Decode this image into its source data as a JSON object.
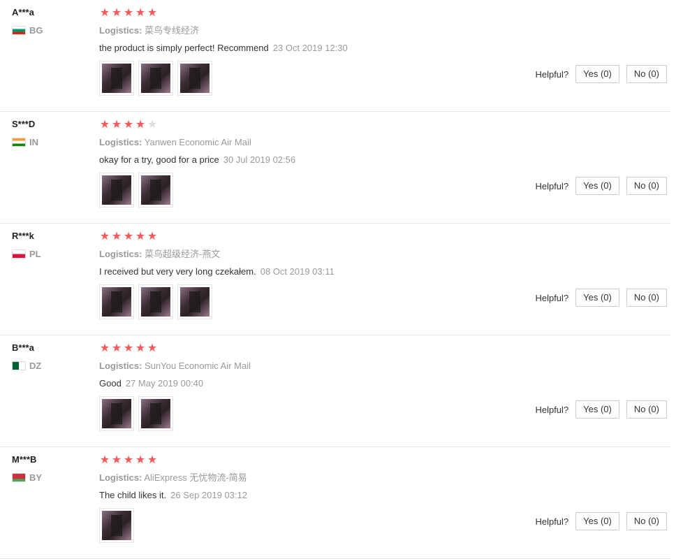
{
  "labels": {
    "logistics": "Logistics:",
    "helpful": "Helpful?"
  },
  "colors": {
    "star_on": "#f2595a",
    "star_off": "#dddddd"
  },
  "reviews": [
    {
      "user": "A***a",
      "country": "BG",
      "rating": 5,
      "logistics": "菜鸟专线经济",
      "text": "the product is simply perfect! Recommend",
      "date": "23 Oct 2019 12:30",
      "image_count": 3,
      "yes": "Yes (0)",
      "no": "No (0)"
    },
    {
      "user": "S***D",
      "country": "IN",
      "rating": 4,
      "logistics": "Yanwen Economic Air Mail",
      "text": "okay for a try, good for a price",
      "date": "30 Jul 2019 02:56",
      "image_count": 2,
      "yes": "Yes (0)",
      "no": "No (0)"
    },
    {
      "user": "R***k",
      "country": "PL",
      "rating": 5,
      "logistics": "菜鸟超级经济-燕文",
      "text": "I received but very very long czekałem.",
      "date": "08 Oct 2019 03:11",
      "image_count": 3,
      "yes": "Yes (0)",
      "no": "No (0)"
    },
    {
      "user": "B***a",
      "country": "DZ",
      "rating": 5,
      "logistics": "SunYou Economic Air Mail",
      "text": "Good",
      "date": "27 May 2019 00:40",
      "image_count": 2,
      "yes": "Yes (0)",
      "no": "No (0)"
    },
    {
      "user": "M***B",
      "country": "BY",
      "rating": 5,
      "logistics": "AliExpress 无忧物流-简易",
      "text": "The child likes it.",
      "date": "26 Sep 2019 03:12",
      "image_count": 1,
      "yes": "Yes (0)",
      "no": "No (0)"
    }
  ]
}
